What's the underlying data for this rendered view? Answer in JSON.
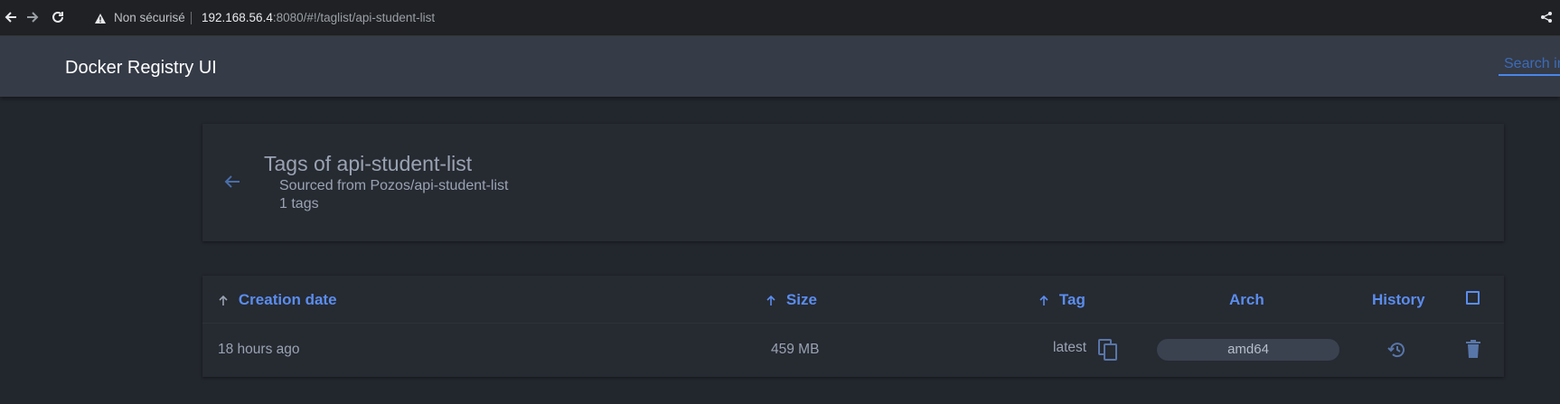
{
  "browser": {
    "security_label": "Non sécurisé",
    "url_host": "192.168.56.4",
    "url_rest": ":8080/#!/taglist/api-student-list"
  },
  "app": {
    "title": "Docker Registry UI",
    "search_placeholder": "Search images"
  },
  "repo_header": {
    "title": "Tags of api-student-list",
    "sourced_from": "Sourced from Pozos/api-student-list",
    "tag_count": "1 tags"
  },
  "table": {
    "headers": {
      "creation_date": "Creation date",
      "size": "Size",
      "tag": "Tag",
      "arch": "Arch",
      "history": "History"
    },
    "rows": [
      {
        "creation_date": "18 hours ago",
        "size": "459 MB",
        "tag": "latest",
        "arch": "amd64"
      }
    ]
  },
  "colors": {
    "accent": "#5b8dee",
    "header_bg": "#353b47",
    "page_bg": "#22262d",
    "card_bg": "#262a31"
  },
  "icons": [
    "back-arrow-icon",
    "forward-arrow-icon",
    "reload-icon",
    "warning-icon",
    "share-icon",
    "arrow-left-icon",
    "sort-arrow-up-icon",
    "copy-icon",
    "history-icon",
    "trash-icon"
  ]
}
